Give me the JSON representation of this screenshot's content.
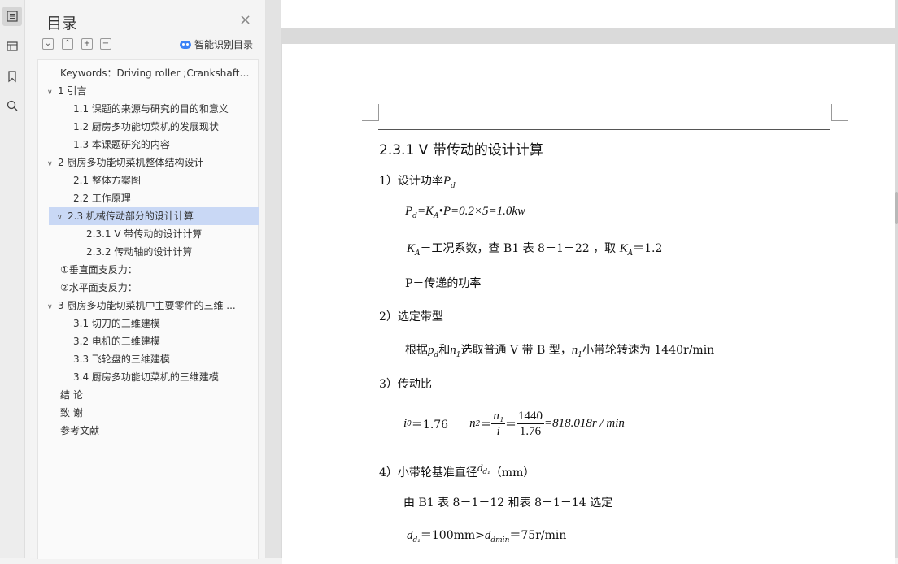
{
  "toc": {
    "title": "目录",
    "close": "×",
    "smart_label": "智能识别目录",
    "items": [
      {
        "label": "Keywords：Driving roller ;Crankshaft; ...",
        "chev": ""
      },
      {
        "label": "1  引言",
        "chev": "v"
      },
      {
        "label": "1.1  课题的来源与研究的目的和意义",
        "chev": ""
      },
      {
        "label": "1.2  厨房多功能切菜机的发展现状",
        "chev": ""
      },
      {
        "label": "1.3  本课题研究的内容",
        "chev": ""
      },
      {
        "label": "2  厨房多功能切菜机整体结构设计",
        "chev": "v"
      },
      {
        "label": "2.1  整体方案图",
        "chev": ""
      },
      {
        "label": "2.2  工作原理",
        "chev": ""
      },
      {
        "label": "2.3  机械传动部分的设计计算",
        "chev": "v"
      },
      {
        "label": "2.3.1 V 带传动的设计计算",
        "chev": ""
      },
      {
        "label": "2.3.2 传动轴的设计计算",
        "chev": ""
      },
      {
        "label": "①垂直面支反力：",
        "chev": ""
      },
      {
        "label": "②水平面支反力：",
        "chev": ""
      },
      {
        "label": "3  厨房多功能切菜机中主要零件的三维 ...",
        "chev": "v"
      },
      {
        "label": "3.1 切刀的三维建模",
        "chev": ""
      },
      {
        "label": "3.2 电机的三维建模",
        "chev": ""
      },
      {
        "label": "3.3 飞轮盘的三维建模",
        "chev": ""
      },
      {
        "label": "3.4 厨房多功能切菜机的三维建模",
        "chev": ""
      },
      {
        "label": "结    论",
        "chev": ""
      },
      {
        "label": "致    谢",
        "chev": ""
      },
      {
        "label": "参考文献",
        "chev": ""
      }
    ]
  },
  "doc": {
    "heading": "2.3.1 V 带传动的设计计算",
    "s1": "1）设计功率",
    "s1_sym": "P",
    "s1_sub": "d",
    "eq1_lhs": "P",
    "eq1_lhs_sub": "d",
    "eq1_mid": "=K",
    "eq1_mid_sub": "A",
    "eq1_rhs": "•P=0.2×5=1.0kw",
    "ka_sym": "K",
    "ka_sub": "A",
    "ka_text": "－工况系数，查 B1 表 8－1－22 ，取",
    "ka_sym2": "K",
    "ka_sub2": "A",
    "ka_val": "＝1.2",
    "p_text": "P－传递的功率",
    "s2": "2）选定带型",
    "s2_text_a": "根据",
    "s2_pd": "p",
    "s2_pd_sub": "d",
    "s2_text_b": "和",
    "s2_n1": "n",
    "s2_n1_sub": "1",
    "s2_text_c": "选取普通 V 带 B 型，",
    "s2_n1b": "n",
    "s2_n1b_sub": "1",
    "s2_text_d": "小带轮转速为 1440r/min",
    "s3": "3）传动比",
    "i0": "i",
    "i0_sub": "0",
    "i0_val": "＝1.76",
    "n2": "n",
    "n2_sub": "2",
    "n2_eq": "＝",
    "f1_num": "n₁",
    "f1_den": "i",
    "eq_sign": "＝",
    "f2_num": "1440",
    "f2_den": "1.76",
    "n2_val": "=818.018r / min",
    "s4": "4）小带轮基准直径",
    "s4_sym": "d",
    "s4_sub": "d₁",
    "s4_unit": "（mm）",
    "s4_text": "由 B1 表 8－1－12 和表 8－1－14 选定",
    "dd1": "d",
    "dd1_sub": "d₁",
    "dd1_val": "＝100mm>",
    "ddmin": "d",
    "ddmin_sub": "dmin",
    "ddmin_val": "＝75r/min"
  }
}
